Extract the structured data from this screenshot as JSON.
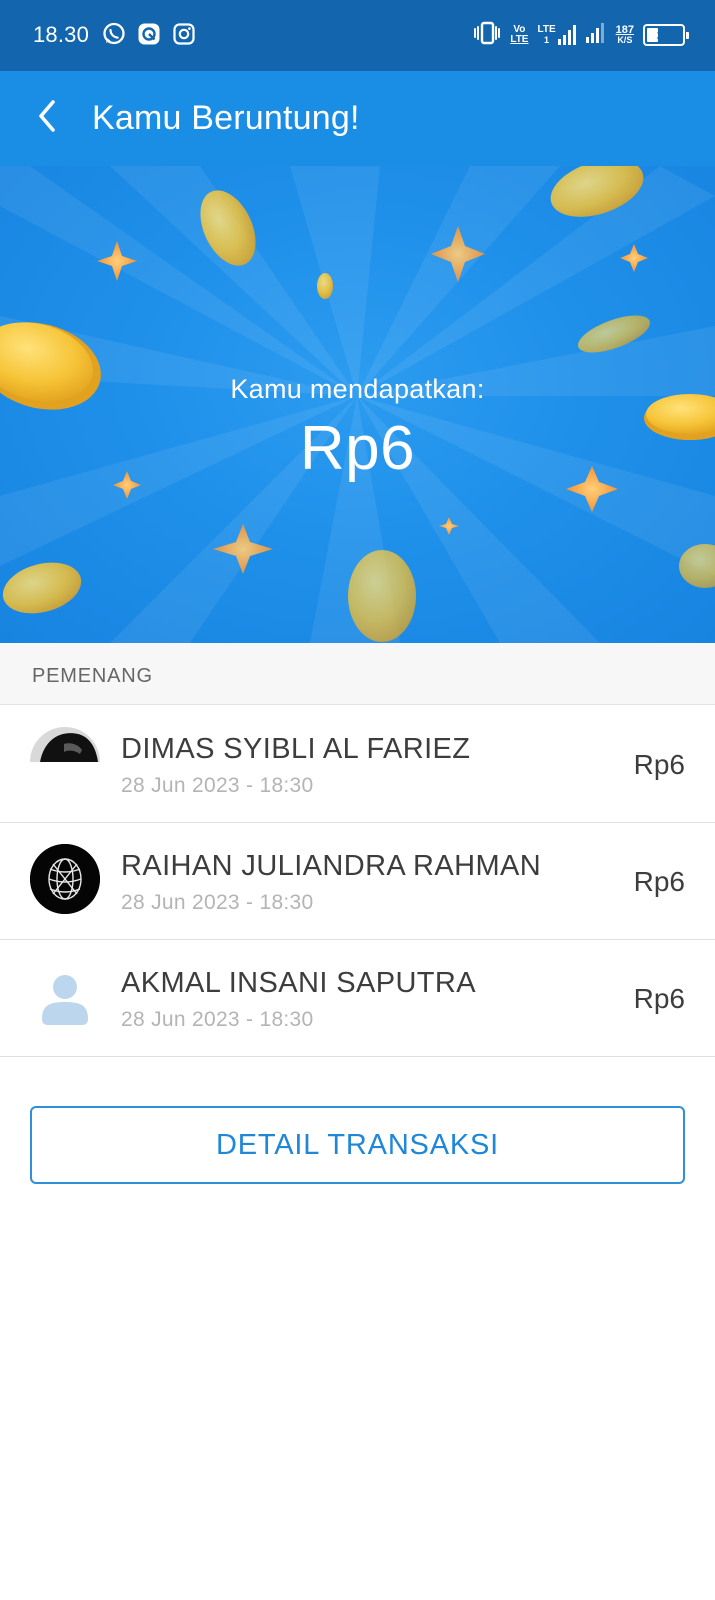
{
  "status_bar": {
    "time": "18.30",
    "icons": [
      "whatsapp-icon",
      "messenger-icon",
      "instagram-icon"
    ],
    "right_icons": [
      "vibrate-icon",
      "volte-icon",
      "lte-signal-icon",
      "signal-icon",
      "data-speed-icon",
      "battery-icon"
    ],
    "volte_top": "Vo",
    "volte_bottom": "LTE",
    "lte_label": "LTE",
    "lte_sub": "1",
    "speed_value": "187",
    "speed_unit": "K/S",
    "battery_level": "31",
    "battery_fraction": 0.31
  },
  "app_bar": {
    "back_icon": "chevron-left-icon",
    "title": "Kamu Beruntung!"
  },
  "banner": {
    "caption": "Kamu mendapatkan:",
    "amount": "Rp6"
  },
  "winners": {
    "section_title": "PEMENANG",
    "items": [
      {
        "name": "DIMAS SYIBLI AL FARIEZ",
        "time": "28 Jun 2023 - 18:30",
        "amount": "Rp6",
        "avatar": "photo-avatar"
      },
      {
        "name": "RAIHAN JULIANDRA RAHMAN",
        "time": "28 Jun 2023 - 18:30",
        "amount": "Rp6",
        "avatar": "globe-logo-avatar"
      },
      {
        "name": "AKMAL INSANI SAPUTRA",
        "time": "28 Jun 2023 - 18:30",
        "amount": "Rp6",
        "avatar": "default-user-avatar"
      }
    ]
  },
  "detail_button": {
    "label": "DETAIL TRANSAKSI"
  },
  "colors": {
    "status_bar": "#1366ad",
    "app_bar": "#1a8de5",
    "banner": "#1f90ea",
    "accent": "#1f86d8",
    "coin": "#f6c437",
    "sparkle": "#f5a13a"
  }
}
